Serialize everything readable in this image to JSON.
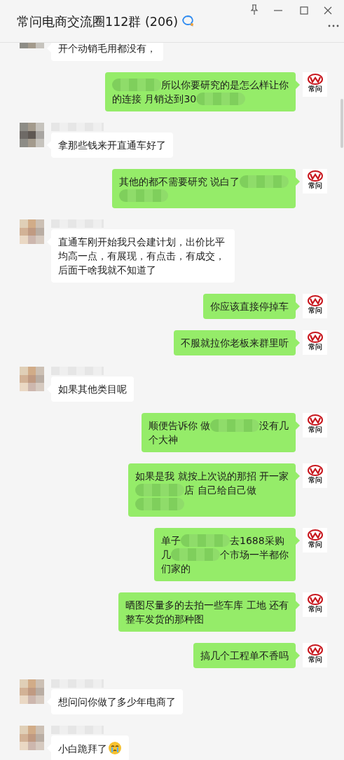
{
  "window": {
    "title": "常问电商交流圈112群 (206)"
  },
  "messages": [
    {
      "kind": "received",
      "parts": [
        {
          "kind": "text",
          "text": "开个动销毛用都没有，"
        }
      ]
    },
    {
      "kind": "sent",
      "avatar_label": "常问",
      "parts": [
        {
          "kind": "blur"
        },
        {
          "kind": "text",
          "text": "所以你要研究的是怎么样让你"
        },
        {
          "kind": "break"
        },
        {
          "kind": "text",
          "text": "的连接  月销达到30"
        },
        {
          "kind": "blur"
        }
      ]
    },
    {
      "kind": "received",
      "parts": [
        {
          "kind": "text",
          "text": "拿那些钱来开直通车好了"
        }
      ]
    },
    {
      "kind": "sent",
      "avatar_label": "常问",
      "parts": [
        {
          "kind": "text",
          "text": "其他的都不需要研究  说白了"
        },
        {
          "kind": "blur"
        },
        {
          "kind": "break"
        },
        {
          "kind": "blur"
        }
      ]
    },
    {
      "kind": "received",
      "parts": [
        {
          "kind": "text",
          "text": "直通车刚开始我只会建计划，出价比平均高一点，有展现，有点击，有成交，后面干啥我就不知道了"
        }
      ]
    },
    {
      "kind": "sent",
      "avatar_label": "常问",
      "parts": [
        {
          "kind": "text",
          "text": "你应该直接停掉车"
        }
      ]
    },
    {
      "kind": "sent",
      "avatar_label": "常问",
      "parts": [
        {
          "kind": "text",
          "text": "不服就拉你老板来群里听"
        }
      ]
    },
    {
      "kind": "received",
      "parts": [
        {
          "kind": "text",
          "text": "如果其他类目呢"
        }
      ]
    },
    {
      "kind": "sent",
      "avatar_label": "常问",
      "parts": [
        {
          "kind": "text",
          "text": "顺便告诉你  做"
        },
        {
          "kind": "blur"
        },
        {
          "kind": "text",
          "text": "没有几"
        },
        {
          "kind": "break"
        },
        {
          "kind": "text",
          "text": "个大神"
        }
      ]
    },
    {
      "kind": "sent",
      "avatar_label": "常问",
      "parts": [
        {
          "kind": "text",
          "text": "如果是我  就按上次说的那招  开一家"
        },
        {
          "kind": "break"
        },
        {
          "kind": "blur"
        },
        {
          "kind": "text",
          "text": "店  自己给自己做"
        },
        {
          "kind": "break"
        },
        {
          "kind": "blur"
        }
      ]
    },
    {
      "kind": "sent",
      "avatar_label": "常问",
      "parts": [
        {
          "kind": "text",
          "text": "单子"
        },
        {
          "kind": "blur"
        },
        {
          "kind": "text",
          "text": "去1688采购"
        },
        {
          "kind": "break"
        },
        {
          "kind": "text",
          "text": "几"
        },
        {
          "kind": "blur"
        },
        {
          "kind": "text",
          "text": "个市场一半都你"
        },
        {
          "kind": "break"
        },
        {
          "kind": "text",
          "text": "们家的"
        }
      ]
    },
    {
      "kind": "sent",
      "avatar_label": "常问",
      "parts": [
        {
          "kind": "text",
          "text": "晒图尽量多的去拍一些车库 工地  还有"
        },
        {
          "kind": "break"
        },
        {
          "kind": "text",
          "text": "整车发货的那种图"
        }
      ]
    },
    {
      "kind": "sent",
      "avatar_label": "常问",
      "parts": [
        {
          "kind": "text",
          "text": "搞几个工程单不香吗"
        }
      ]
    },
    {
      "kind": "received",
      "parts": [
        {
          "kind": "text",
          "text": "想问问你做了多少年电商了"
        }
      ]
    },
    {
      "kind": "received",
      "parts": [
        {
          "kind": "text",
          "text": "小白跪拜了"
        },
        {
          "kind": "emoji"
        }
      ]
    }
  ]
}
